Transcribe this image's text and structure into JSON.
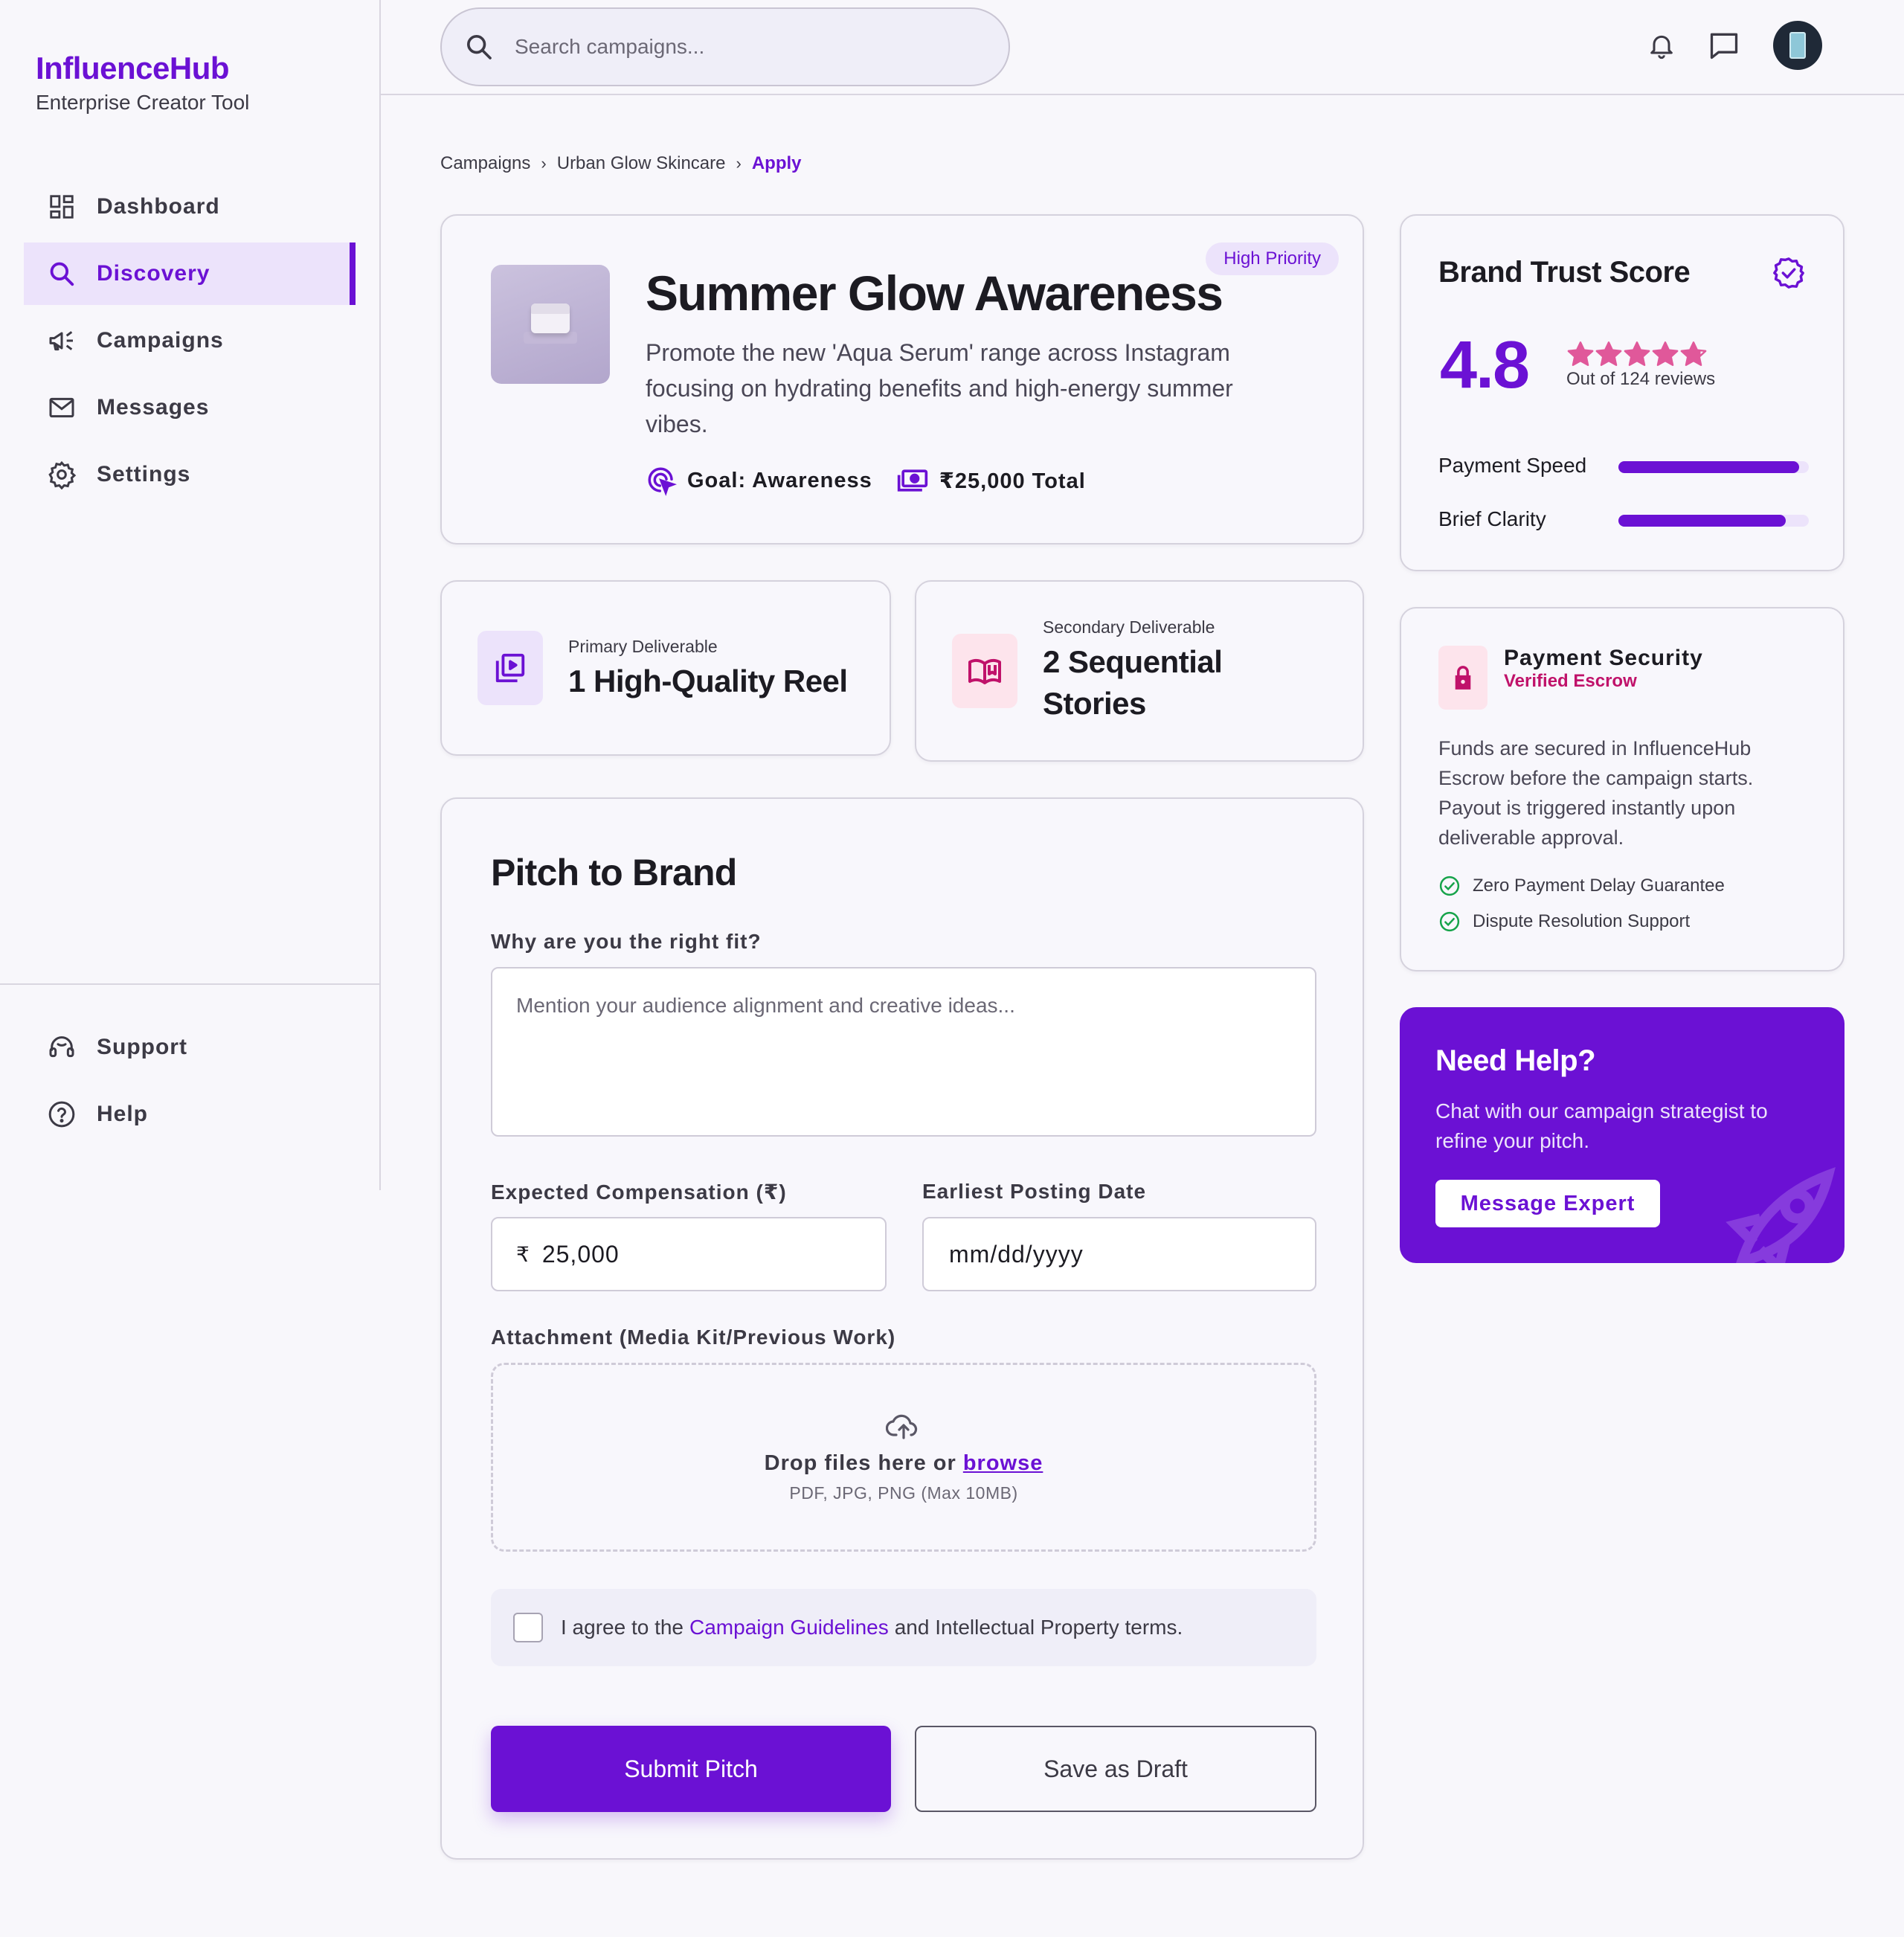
{
  "brand": {
    "name": "InfluenceHub",
    "tagline": "Enterprise Creator Tool"
  },
  "nav": {
    "items": [
      {
        "label": "Dashboard",
        "icon": "dashboard-icon"
      },
      {
        "label": "Discovery",
        "icon": "search-icon",
        "active": true
      },
      {
        "label": "Campaigns",
        "icon": "megaphone-icon"
      },
      {
        "label": "Messages",
        "icon": "mail-icon"
      },
      {
        "label": "Settings",
        "icon": "gear-icon"
      }
    ],
    "bottom": [
      {
        "label": "Support",
        "icon": "headset-icon"
      },
      {
        "label": "Help",
        "icon": "help-circle-icon"
      }
    ]
  },
  "search": {
    "placeholder": "Search campaigns..."
  },
  "breadcrumb": {
    "items": [
      "Campaigns",
      "Urban Glow Skincare"
    ],
    "current": "Apply"
  },
  "campaign": {
    "priority": "High Priority",
    "title": "Summer Glow Awareness",
    "description": "Promote the new 'Aqua Serum' range across Instagram focusing on hydrating benefits and high-energy summer vibes.",
    "goal": "Goal: Awareness",
    "budget": "₹25,000 Total"
  },
  "deliverables": {
    "primary": {
      "label": "Primary Deliverable",
      "value": "1 High-Quality Reel"
    },
    "secondary": {
      "label": "Secondary Deliverable",
      "value_line1": "2 Sequential",
      "value_line2": "Stories"
    }
  },
  "pitch": {
    "title": "Pitch to Brand",
    "fit_label": "Why are you the right fit?",
    "fit_placeholder": "Mention your audience alignment and creative ideas...",
    "comp_label": "Expected Compensation (₹)",
    "comp_currency": "₹",
    "comp_value": "25,000",
    "date_label": "Earliest Posting Date",
    "date_placeholder": "mm/dd/yyyy",
    "attach_label": "Attachment (Media Kit/Previous Work)",
    "drop_text": "Drop files here or",
    "drop_link": "browse",
    "drop_hint": "PDF, JPG, PNG (Max 10MB)",
    "agree_prefix": "I agree to the",
    "agree_link": "Campaign Guidelines",
    "agree_suffix": "and Intellectual Property terms.",
    "submit": "Submit Pitch",
    "draft": "Save as Draft"
  },
  "trust": {
    "title": "Brand Trust Score",
    "score": "4.8",
    "rating": 4.8,
    "reviews": "Out of 124 reviews",
    "metrics": [
      {
        "label": "Payment Speed",
        "value": 0.95
      },
      {
        "label": "Brief Clarity",
        "value": 0.88
      }
    ]
  },
  "security": {
    "title": "Payment Security",
    "subtitle": "Verified Escrow",
    "description": "Funds are secured in InfluenceHub Escrow before the campaign starts. Payout is triggered instantly upon deliverable approval.",
    "checks": [
      "Zero Payment Delay Guarantee",
      "Dispute Resolution Support"
    ]
  },
  "help": {
    "title": "Need Help?",
    "text": "Chat with our campaign strategist to refine your pitch.",
    "button": "Message Expert"
  },
  "colors": {
    "accent": "#6b11d4",
    "accent_light": "#ece3fb",
    "pink": "#c0126a",
    "star": "#e0589a",
    "success": "#16a34a"
  }
}
